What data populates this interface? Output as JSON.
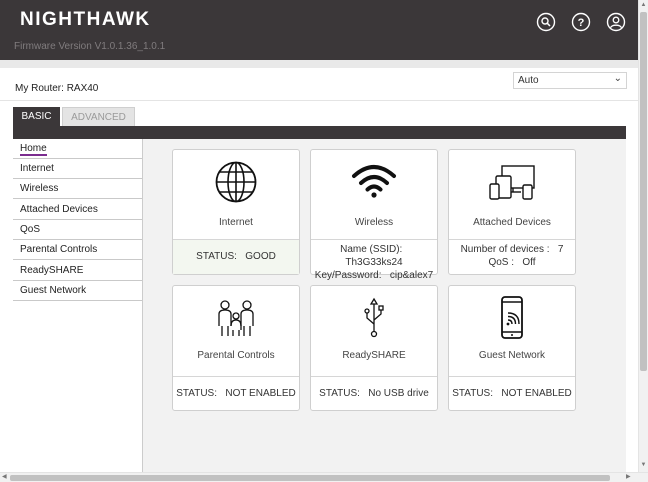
{
  "header": {
    "brand": "NIGHTHAWK",
    "firmware": "Firmware Version V1.0.1.36_1.0.1",
    "icons": [
      "search-icon",
      "help-icon",
      "user-icon"
    ]
  },
  "router": {
    "label": "My Router:",
    "name": "RAX40"
  },
  "language_select": {
    "value": "Auto"
  },
  "tabs": [
    {
      "label": "BASIC",
      "active": true
    },
    {
      "label": "ADVANCED",
      "active": false
    }
  ],
  "sidebar": {
    "items": [
      {
        "label": "Home",
        "active": true
      },
      {
        "label": "Internet"
      },
      {
        "label": "Wireless"
      },
      {
        "label": "Attached Devices"
      },
      {
        "label": "QoS"
      },
      {
        "label": "Parental Controls"
      },
      {
        "label": "ReadySHARE"
      },
      {
        "label": "Guest Network"
      }
    ]
  },
  "cards": {
    "internet": {
      "title": "Internet",
      "icon": "globe-icon",
      "status_label": "STATUS:",
      "status_value": "GOOD"
    },
    "wireless": {
      "title": "Wireless",
      "icon": "wifi-icon",
      "ssid_label": "Name (SSID):",
      "ssid_value": "Th3G33ks24",
      "key_label": "Key/Password:",
      "key_value": "cip&alex7"
    },
    "attached": {
      "title": "Attached Devices",
      "icon": "devices-icon",
      "count_label": "Number of devices :",
      "count_value": "7",
      "qos_label": "QoS :",
      "qos_value": "Off"
    },
    "parental": {
      "title": "Parental Controls",
      "icon": "family-icon",
      "status_label": "STATUS:",
      "status_value": "NOT ENABLED"
    },
    "readyshare": {
      "title": "ReadySHARE",
      "icon": "usb-icon",
      "status_label": "STATUS:",
      "status_value": "No USB drive"
    },
    "guest": {
      "title": "Guest Network",
      "icon": "phone-wifi-icon",
      "status_label": "STATUS:",
      "status_value": "NOT ENABLED"
    }
  },
  "colors": {
    "header_bg": "#3b3739",
    "active_underline": "#7b2c8f",
    "good_bg": "#f3f7f0"
  }
}
